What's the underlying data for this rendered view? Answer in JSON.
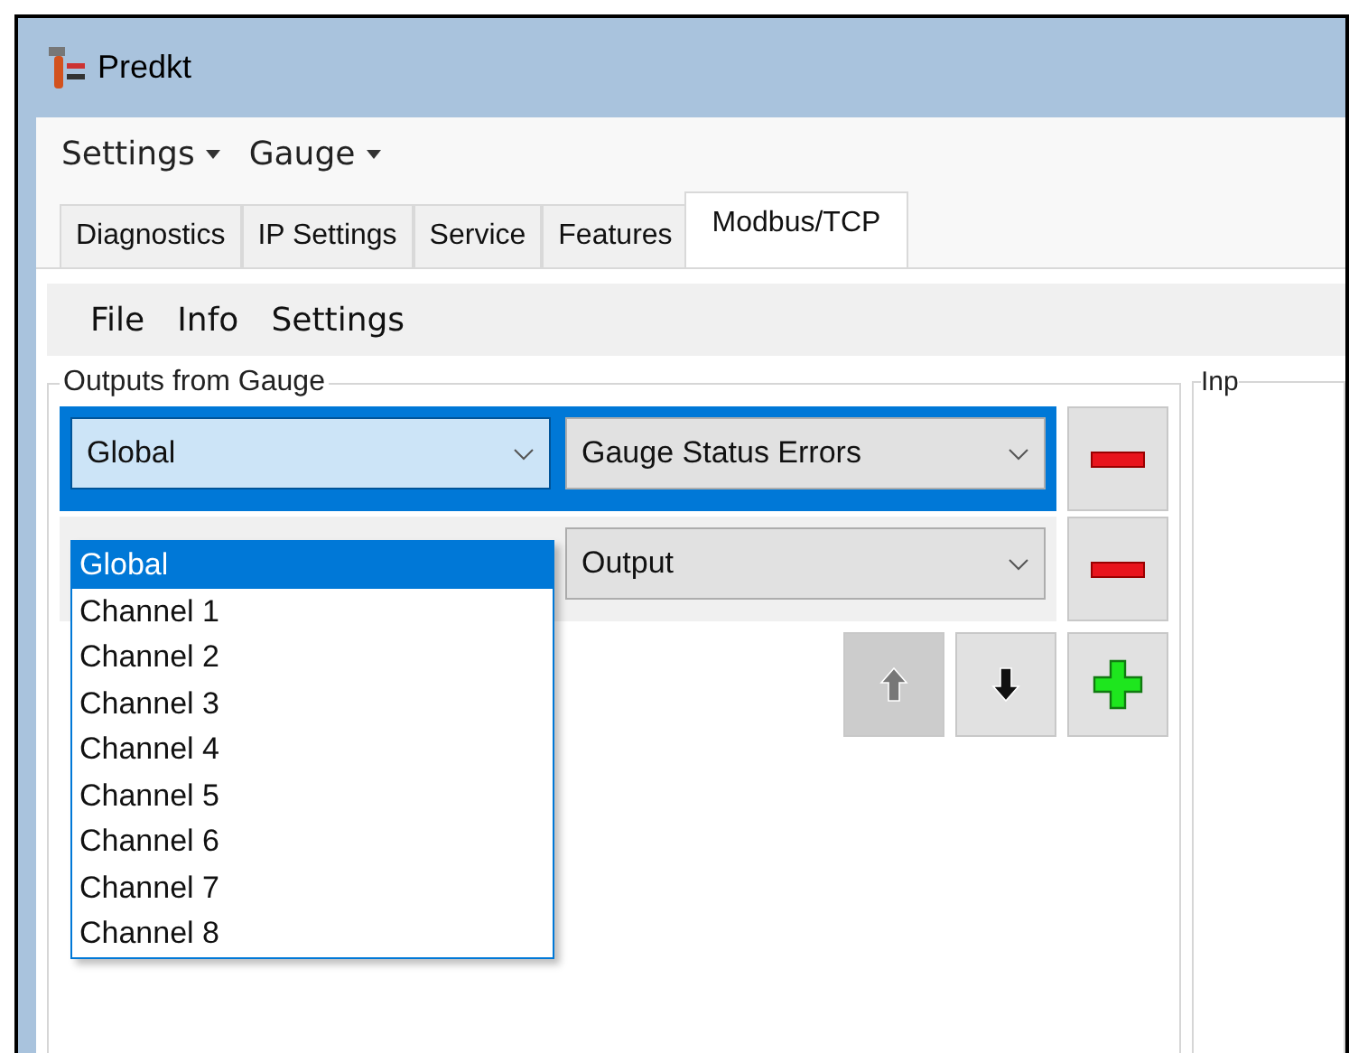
{
  "window": {
    "title": "Predkt"
  },
  "menu": [
    {
      "label": "Settings"
    },
    {
      "label": "Gauge"
    }
  ],
  "tabs": [
    {
      "label": "Diagnostics",
      "selected": false
    },
    {
      "label": "IP Settings",
      "selected": false
    },
    {
      "label": "Service",
      "selected": false
    },
    {
      "label": "Features",
      "selected": false
    },
    {
      "label": "Modbus/TCP",
      "selected": true
    }
  ],
  "toolbar": [
    "File",
    "Info",
    "Settings"
  ],
  "outputs_group": {
    "title": "Outputs from Gauge",
    "rows": [
      {
        "selected": true,
        "source": "Global",
        "signal": "Gauge Status Errors"
      },
      {
        "selected": false,
        "signal": "Output"
      }
    ],
    "dropdown": [
      {
        "label": "Global",
        "selected": true
      },
      {
        "label": "Channel 1",
        "selected": false
      },
      {
        "label": "Channel 2",
        "selected": false
      },
      {
        "label": "Channel 3",
        "selected": false
      },
      {
        "label": "Channel 4",
        "selected": false
      },
      {
        "label": "Channel 5",
        "selected": false
      },
      {
        "label": "Channel 6",
        "selected": false
      },
      {
        "label": "Channel 7",
        "selected": false
      },
      {
        "label": "Channel 8",
        "selected": false
      }
    ],
    "move_up": {
      "disabled": true
    },
    "move_down": {
      "disabled": false
    }
  },
  "inputs_group": {
    "title": "Inp"
  }
}
